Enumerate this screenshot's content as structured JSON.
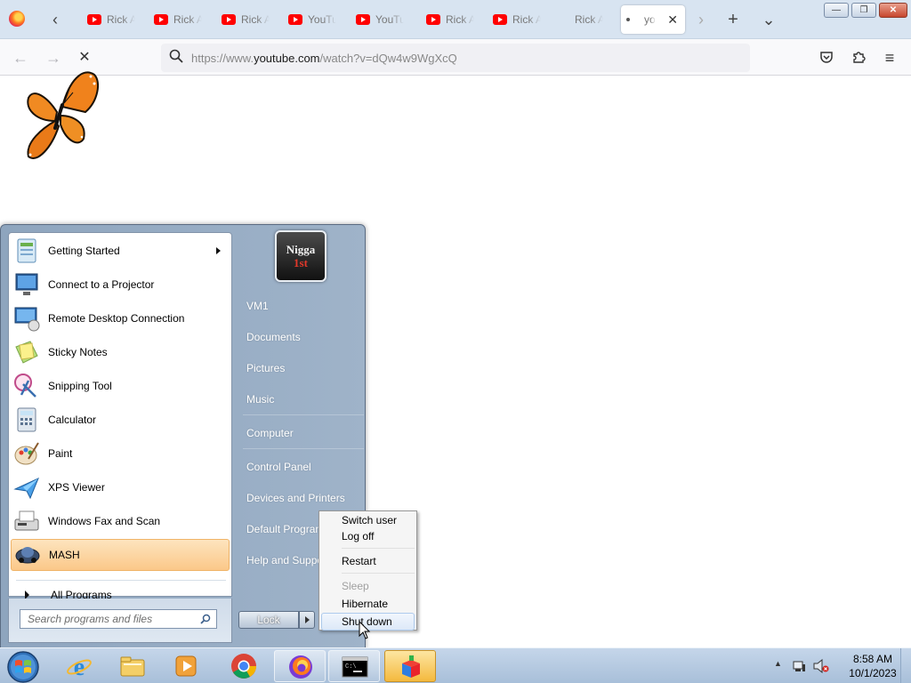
{
  "browser": {
    "tabs": [
      {
        "label": "Rick A",
        "icon": "youtube-icon"
      },
      {
        "label": "Rick A",
        "icon": "youtube-icon"
      },
      {
        "label": "Rick A",
        "icon": "youtube-icon"
      },
      {
        "label": "YouTu",
        "icon": "youtube-icon"
      },
      {
        "label": "YouTu",
        "icon": "youtube-icon"
      },
      {
        "label": "Rick A",
        "icon": "youtube-icon"
      },
      {
        "label": "Rick A",
        "icon": "youtube-icon"
      },
      {
        "label": "Rick A",
        "icon": ""
      }
    ],
    "active_tab": {
      "label": "yo",
      "close": "✕"
    },
    "url_host_prefix": "https://www.",
    "url_domain": "youtube.com",
    "url_path": "/watch?v=dQw4w9WgXcQ",
    "icons": {
      "back": "←",
      "forward": "→",
      "stop": "✕",
      "search": "⌕",
      "tab_scroll_left": "‹",
      "tab_scroll_right": "›",
      "new_tab": "+",
      "list_all_tabs": "⌄",
      "pocket": "pocket-icon",
      "extensions": "puzzle-icon",
      "menu": "≡"
    },
    "window_controls": {
      "minimize": "—",
      "restore": "❐",
      "close": "✕"
    }
  },
  "start_menu": {
    "programs": [
      {
        "label": "Getting Started",
        "icon": "getting-started-icon",
        "has_submenu": true
      },
      {
        "label": "Connect to a Projector",
        "icon": "projector-icon"
      },
      {
        "label": "Remote Desktop Connection",
        "icon": "remote-desktop-icon"
      },
      {
        "label": "Sticky Notes",
        "icon": "sticky-notes-icon"
      },
      {
        "label": "Snipping Tool",
        "icon": "snipping-tool-icon"
      },
      {
        "label": "Calculator",
        "icon": "calculator-icon"
      },
      {
        "label": "Paint",
        "icon": "paint-icon"
      },
      {
        "label": "XPS Viewer",
        "icon": "xps-viewer-icon"
      },
      {
        "label": "Windows Fax and Scan",
        "icon": "fax-scan-icon"
      },
      {
        "label": "MASH",
        "icon": "mash-icon",
        "highlighted": true
      }
    ],
    "all_programs": "All Programs",
    "search_placeholder": "Search programs and files",
    "avatar_text_top": "Nigga",
    "avatar_text_bottom": "1st",
    "links": {
      "user": "VM1",
      "documents": "Documents",
      "pictures": "Pictures",
      "music": "Music",
      "computer": "Computer",
      "control_panel": "Control Panel",
      "devices": "Devices and Printers",
      "default_programs": "Default Programs",
      "help": "Help and Support"
    },
    "lock_button": "Lock",
    "colors": {
      "highlight": "#fbc889",
      "pane": "#9fb3c9"
    }
  },
  "shutdown_menu": {
    "switch_user": "Switch user",
    "log_off": "Log off",
    "restart": "Restart",
    "sleep": "Sleep",
    "hibernate": "Hibernate",
    "shut_down": "Shut down"
  },
  "taskbar": {
    "items": [
      "internet-explorer-icon",
      "windows-explorer-icon",
      "media-player-icon",
      "chrome-icon",
      "firefox-icon",
      "command-prompt-icon",
      "mash-icon"
    ],
    "clock_time": "8:58 AM",
    "clock_date": "10/1/2023",
    "tray_chevron": "▲"
  }
}
